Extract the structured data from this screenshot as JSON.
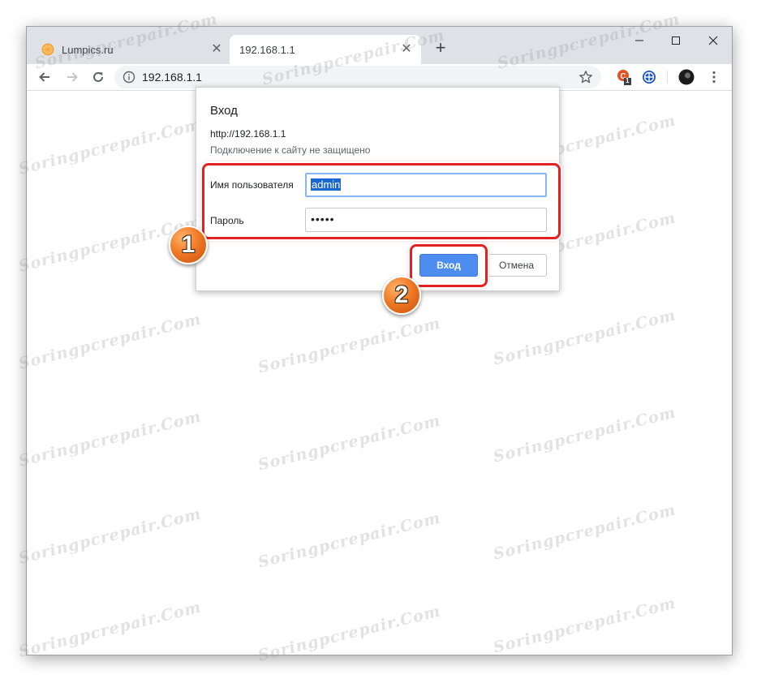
{
  "browser": {
    "tabs": [
      {
        "title": "Lumpics.ru",
        "favicon": "orange-slice-icon",
        "active": false
      },
      {
        "title": "192.168.1.1",
        "active": true
      }
    ],
    "address": "192.168.1.1",
    "extension_badge": "1"
  },
  "auth_dialog": {
    "title": "Вход",
    "url": "http://192.168.1.1",
    "note": "Подключение к сайту не защищено",
    "username_label": "Имя пользователя",
    "username_value": "admin",
    "password_label": "Пароль",
    "password_value": "•••••",
    "login_button": "Вход",
    "cancel_button": "Отмена"
  },
  "annotations": {
    "step1": "1",
    "step2": "2",
    "highlight_color": "#e32121",
    "badge_color": "#f07a26"
  },
  "watermark": "Soringpcrepair.Com"
}
